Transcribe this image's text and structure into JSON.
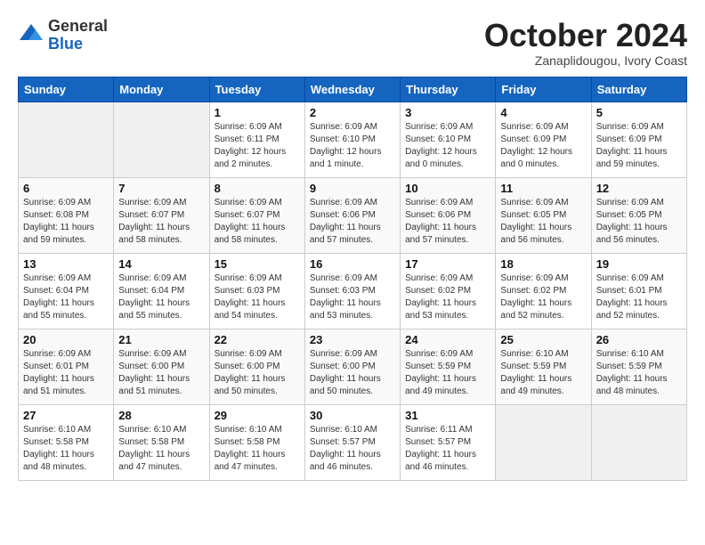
{
  "logo": {
    "general": "General",
    "blue": "Blue"
  },
  "title": "October 2024",
  "subtitle": "Zanaplidougou, Ivory Coast",
  "days_header": [
    "Sunday",
    "Monday",
    "Tuesday",
    "Wednesday",
    "Thursday",
    "Friday",
    "Saturday"
  ],
  "weeks": [
    [
      {
        "num": "",
        "info": ""
      },
      {
        "num": "",
        "info": ""
      },
      {
        "num": "1",
        "info": "Sunrise: 6:09 AM\nSunset: 6:11 PM\nDaylight: 12 hours\nand 2 minutes."
      },
      {
        "num": "2",
        "info": "Sunrise: 6:09 AM\nSunset: 6:10 PM\nDaylight: 12 hours\nand 1 minute."
      },
      {
        "num": "3",
        "info": "Sunrise: 6:09 AM\nSunset: 6:10 PM\nDaylight: 12 hours\nand 0 minutes."
      },
      {
        "num": "4",
        "info": "Sunrise: 6:09 AM\nSunset: 6:09 PM\nDaylight: 12 hours\nand 0 minutes."
      },
      {
        "num": "5",
        "info": "Sunrise: 6:09 AM\nSunset: 6:09 PM\nDaylight: 11 hours\nand 59 minutes."
      }
    ],
    [
      {
        "num": "6",
        "info": "Sunrise: 6:09 AM\nSunset: 6:08 PM\nDaylight: 11 hours\nand 59 minutes."
      },
      {
        "num": "7",
        "info": "Sunrise: 6:09 AM\nSunset: 6:07 PM\nDaylight: 11 hours\nand 58 minutes."
      },
      {
        "num": "8",
        "info": "Sunrise: 6:09 AM\nSunset: 6:07 PM\nDaylight: 11 hours\nand 58 minutes."
      },
      {
        "num": "9",
        "info": "Sunrise: 6:09 AM\nSunset: 6:06 PM\nDaylight: 11 hours\nand 57 minutes."
      },
      {
        "num": "10",
        "info": "Sunrise: 6:09 AM\nSunset: 6:06 PM\nDaylight: 11 hours\nand 57 minutes."
      },
      {
        "num": "11",
        "info": "Sunrise: 6:09 AM\nSunset: 6:05 PM\nDaylight: 11 hours\nand 56 minutes."
      },
      {
        "num": "12",
        "info": "Sunrise: 6:09 AM\nSunset: 6:05 PM\nDaylight: 11 hours\nand 56 minutes."
      }
    ],
    [
      {
        "num": "13",
        "info": "Sunrise: 6:09 AM\nSunset: 6:04 PM\nDaylight: 11 hours\nand 55 minutes."
      },
      {
        "num": "14",
        "info": "Sunrise: 6:09 AM\nSunset: 6:04 PM\nDaylight: 11 hours\nand 55 minutes."
      },
      {
        "num": "15",
        "info": "Sunrise: 6:09 AM\nSunset: 6:03 PM\nDaylight: 11 hours\nand 54 minutes."
      },
      {
        "num": "16",
        "info": "Sunrise: 6:09 AM\nSunset: 6:03 PM\nDaylight: 11 hours\nand 53 minutes."
      },
      {
        "num": "17",
        "info": "Sunrise: 6:09 AM\nSunset: 6:02 PM\nDaylight: 11 hours\nand 53 minutes."
      },
      {
        "num": "18",
        "info": "Sunrise: 6:09 AM\nSunset: 6:02 PM\nDaylight: 11 hours\nand 52 minutes."
      },
      {
        "num": "19",
        "info": "Sunrise: 6:09 AM\nSunset: 6:01 PM\nDaylight: 11 hours\nand 52 minutes."
      }
    ],
    [
      {
        "num": "20",
        "info": "Sunrise: 6:09 AM\nSunset: 6:01 PM\nDaylight: 11 hours\nand 51 minutes."
      },
      {
        "num": "21",
        "info": "Sunrise: 6:09 AM\nSunset: 6:00 PM\nDaylight: 11 hours\nand 51 minutes."
      },
      {
        "num": "22",
        "info": "Sunrise: 6:09 AM\nSunset: 6:00 PM\nDaylight: 11 hours\nand 50 minutes."
      },
      {
        "num": "23",
        "info": "Sunrise: 6:09 AM\nSunset: 6:00 PM\nDaylight: 11 hours\nand 50 minutes."
      },
      {
        "num": "24",
        "info": "Sunrise: 6:09 AM\nSunset: 5:59 PM\nDaylight: 11 hours\nand 49 minutes."
      },
      {
        "num": "25",
        "info": "Sunrise: 6:10 AM\nSunset: 5:59 PM\nDaylight: 11 hours\nand 49 minutes."
      },
      {
        "num": "26",
        "info": "Sunrise: 6:10 AM\nSunset: 5:59 PM\nDaylight: 11 hours\nand 48 minutes."
      }
    ],
    [
      {
        "num": "27",
        "info": "Sunrise: 6:10 AM\nSunset: 5:58 PM\nDaylight: 11 hours\nand 48 minutes."
      },
      {
        "num": "28",
        "info": "Sunrise: 6:10 AM\nSunset: 5:58 PM\nDaylight: 11 hours\nand 47 minutes."
      },
      {
        "num": "29",
        "info": "Sunrise: 6:10 AM\nSunset: 5:58 PM\nDaylight: 11 hours\nand 47 minutes."
      },
      {
        "num": "30",
        "info": "Sunrise: 6:10 AM\nSunset: 5:57 PM\nDaylight: 11 hours\nand 46 minutes."
      },
      {
        "num": "31",
        "info": "Sunrise: 6:11 AM\nSunset: 5:57 PM\nDaylight: 11 hours\nand 46 minutes."
      },
      {
        "num": "",
        "info": ""
      },
      {
        "num": "",
        "info": ""
      }
    ]
  ]
}
